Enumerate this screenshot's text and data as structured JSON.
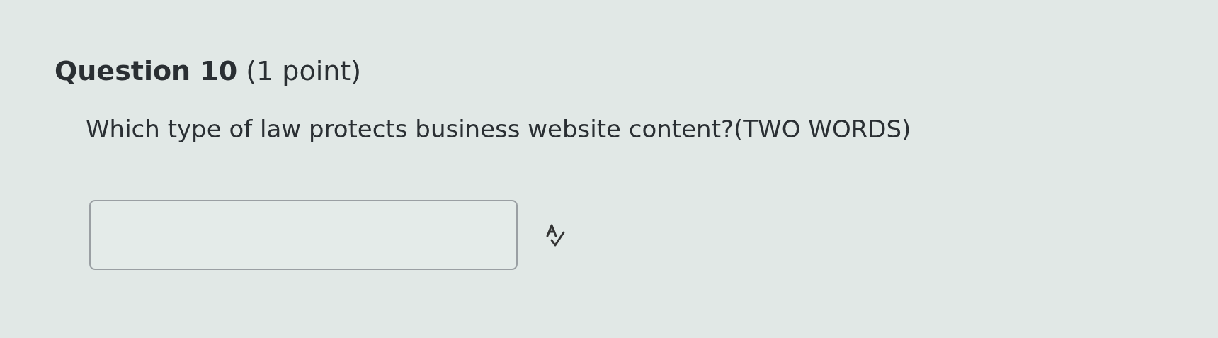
{
  "question": {
    "title": "Question 10",
    "points": "(1 point)",
    "prompt": "Which type of law protects business website content?(TWO WORDS)"
  }
}
